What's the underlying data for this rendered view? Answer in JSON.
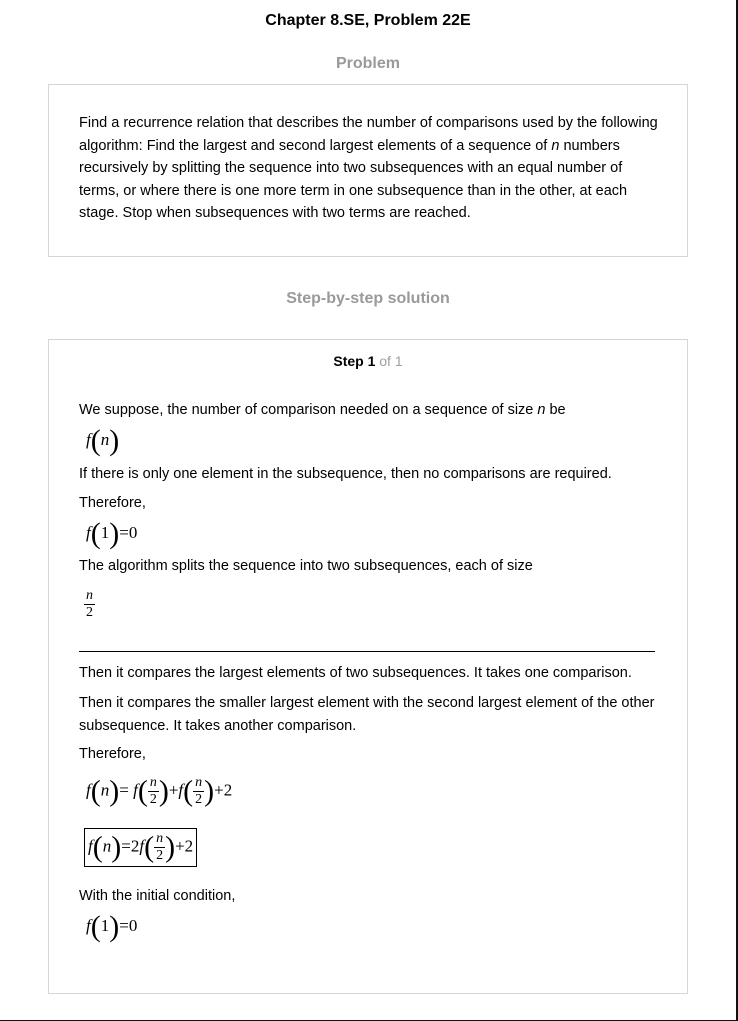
{
  "header": {
    "title": "Chapter 8.SE, Problem 22E"
  },
  "problem": {
    "heading": "Problem",
    "text_before_n": "Find a recurrence relation that describes the number of comparisons used by the following algorithm: Find the largest and second largest elements of a sequence of ",
    "n": "n",
    "text_after_n": " numbers recursively by splitting the sequence into two subsequences with an equal number of terms, or where there is one more term in one subsequence than in the other, at each stage. Stop when subsequences with two terms are reached."
  },
  "solution": {
    "heading": "Step-by-step solution",
    "step_word": "Step 1",
    "step_of": " of 1"
  },
  "steps": {
    "p1_before_n": "We suppose, the number of comparison needed on a sequence of size ",
    "p1_n": "n",
    "p1_after_n": " be",
    "p2": "If there is only one element in the subsequence, then no comparisons are required.",
    "p3": "Therefore,",
    "p4": "The algorithm splits the sequence into two subsequences, each of size",
    "p5": "Then it compares the largest elements of two subsequences. It takes one comparison.",
    "p6": "Then it compares the smaller largest element with the second largest element of the other subsequence. It takes another comparison.",
    "p7": "Therefore,",
    "p8": "With the initial condition,"
  },
  "math": {
    "f": "f",
    "n": "n",
    "one": "1",
    "zero": "0",
    "two": "2",
    "eq": "=",
    "plus2": "+2",
    "plus": "+",
    "coef2": "2"
  }
}
